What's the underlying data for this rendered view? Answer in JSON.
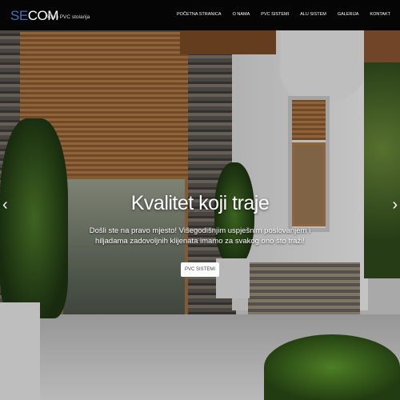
{
  "header": {
    "logo_se": "SE",
    "logo_com": "COM",
    "tagline": "ALU i PVC stolarija",
    "nav": [
      "POČETNA STRANICA",
      "O NAMA",
      "PVC SISTEMI",
      "ALU SISTEM",
      "GALERIJA",
      "KONTAKT"
    ]
  },
  "hero": {
    "title": "Kvalitet koji traje",
    "subtitle_line1": "Došli ste na pravo mjesto! Višegodišnjim uspješnim poslovanjem i",
    "subtitle_line2": "hiljadama zadovoljnih klijenata imamo za svakog ono što traži!",
    "button_label": "PVC SISTEMI",
    "prev_icon": "‹",
    "next_icon": "›"
  }
}
